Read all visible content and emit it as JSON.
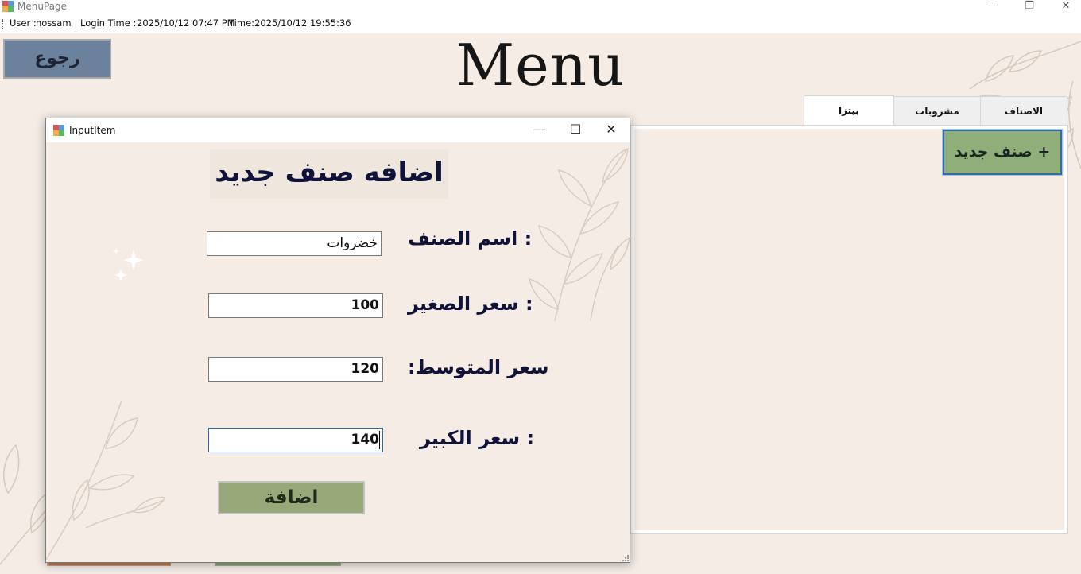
{
  "window": {
    "title": "MenuPage",
    "minimize_glyph": "—",
    "restore_glyph": "❐",
    "close_glyph": "✕"
  },
  "status": {
    "user_label": "User :",
    "user_value": "hossam",
    "login_label": "Login Time :",
    "login_value": "2025/10/12 07:47 PM",
    "time_label": "Time:",
    "time_value": "2025/10/12 19:55:36"
  },
  "back_button": {
    "label": "رجوع"
  },
  "page_title": "Menu",
  "tabs": [
    {
      "label": "الاصناف",
      "active": false
    },
    {
      "label": "مشروبات",
      "active": false
    },
    {
      "label": "بيتزا",
      "active": true
    }
  ],
  "new_item_button": {
    "label": "صنف جديد +"
  },
  "dialog": {
    "title": "InputItem",
    "minimize_glyph": "—",
    "maximize_glyph": "☐",
    "close_glyph": "✕",
    "heading": "اضافه صنف جديد",
    "fields": [
      {
        "label": ": اسم الصنف",
        "value": "خضروات"
      },
      {
        "label": ": سعر الصغير",
        "value": "100"
      },
      {
        "label": "سعر المتوسط:",
        "value": "120"
      },
      {
        "label": ": سعر الكبير",
        "value": "140"
      }
    ],
    "submit_label": "اضافة"
  },
  "colors": {
    "background": "#f5ece6",
    "back_button": "#6b819c",
    "new_item_button": "#8fae7a",
    "add_button": "#98a878",
    "heading_text": "#10123a",
    "focus_border": "#2c6bb0"
  },
  "icons": {
    "app": "app-window-icon",
    "dialog": "app-window-icon"
  }
}
